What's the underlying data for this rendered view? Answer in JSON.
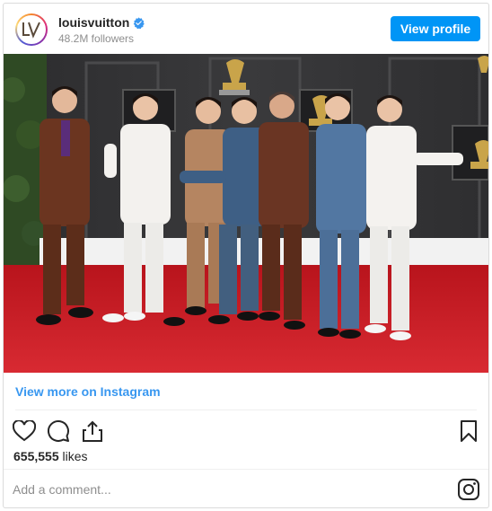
{
  "header": {
    "username": "louisvuitton",
    "followers": "48.2M followers",
    "view_profile_label": "View profile",
    "avatar_icon": "lv-monogram-icon",
    "verified_icon": "verified-badge-icon",
    "verified_color": "#3897f0"
  },
  "post": {
    "image_icon": "photo-image",
    "view_more_label": "View more on Instagram",
    "likes_count": "655,555",
    "likes_word": "likes",
    "comment_placeholder": "Add a comment...",
    "actions": [
      "heart-icon",
      "comment-icon",
      "share-icon"
    ],
    "bookmark_icon": "bookmark-icon",
    "instagram_icon": "instagram-logo-icon"
  },
  "colors": {
    "accent": "#0095f6",
    "link": "#3897f0",
    "muted": "#8e8e8e",
    "border": "#dbdbdb"
  }
}
